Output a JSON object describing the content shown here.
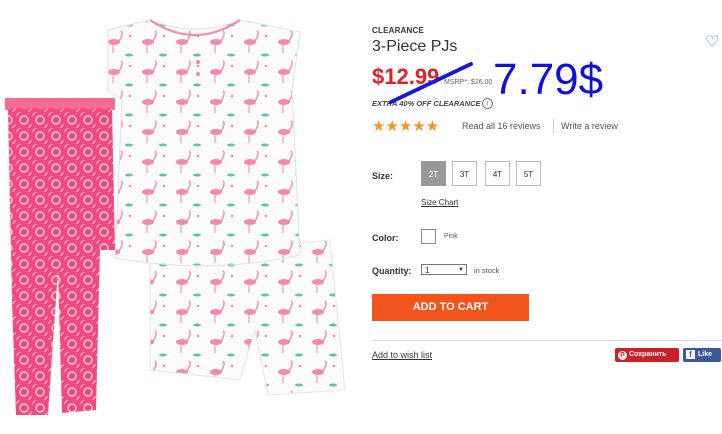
{
  "product": {
    "badge": "CLEARANCE",
    "title": "3-Piece PJs",
    "price": "$12.99",
    "msrp": "MSRP*: $26.00",
    "extra_offer": "EXTRA 40% OFF CLEARANCE",
    "annotation": "7.79$",
    "rating_stars": "★★★★★",
    "rating": 5,
    "reviews_link": "Read all 16 reviews",
    "write_review": "Write a review"
  },
  "options": {
    "size_label": "Size:",
    "sizes": [
      "2T",
      "3T",
      "4T",
      "5T"
    ],
    "selected_size": "2T",
    "size_chart": "Size Chart",
    "color_label": "Color:",
    "color_name": "Pink",
    "quantity_label": "Quantity:",
    "quantity_value": "1",
    "stock_status": "in stock"
  },
  "actions": {
    "add_to_cart": "ADD TO CART",
    "wish_list": "Add to wish list",
    "pinterest": "Сохранить",
    "facebook": "Like"
  },
  "colors": {
    "price": "#e0202b",
    "add_to_cart_bg": "#f2541b",
    "stars": "#f7941d",
    "annotation": "#1010d8",
    "pants": "#f24a7e",
    "flamingo": "#f58aa6"
  }
}
